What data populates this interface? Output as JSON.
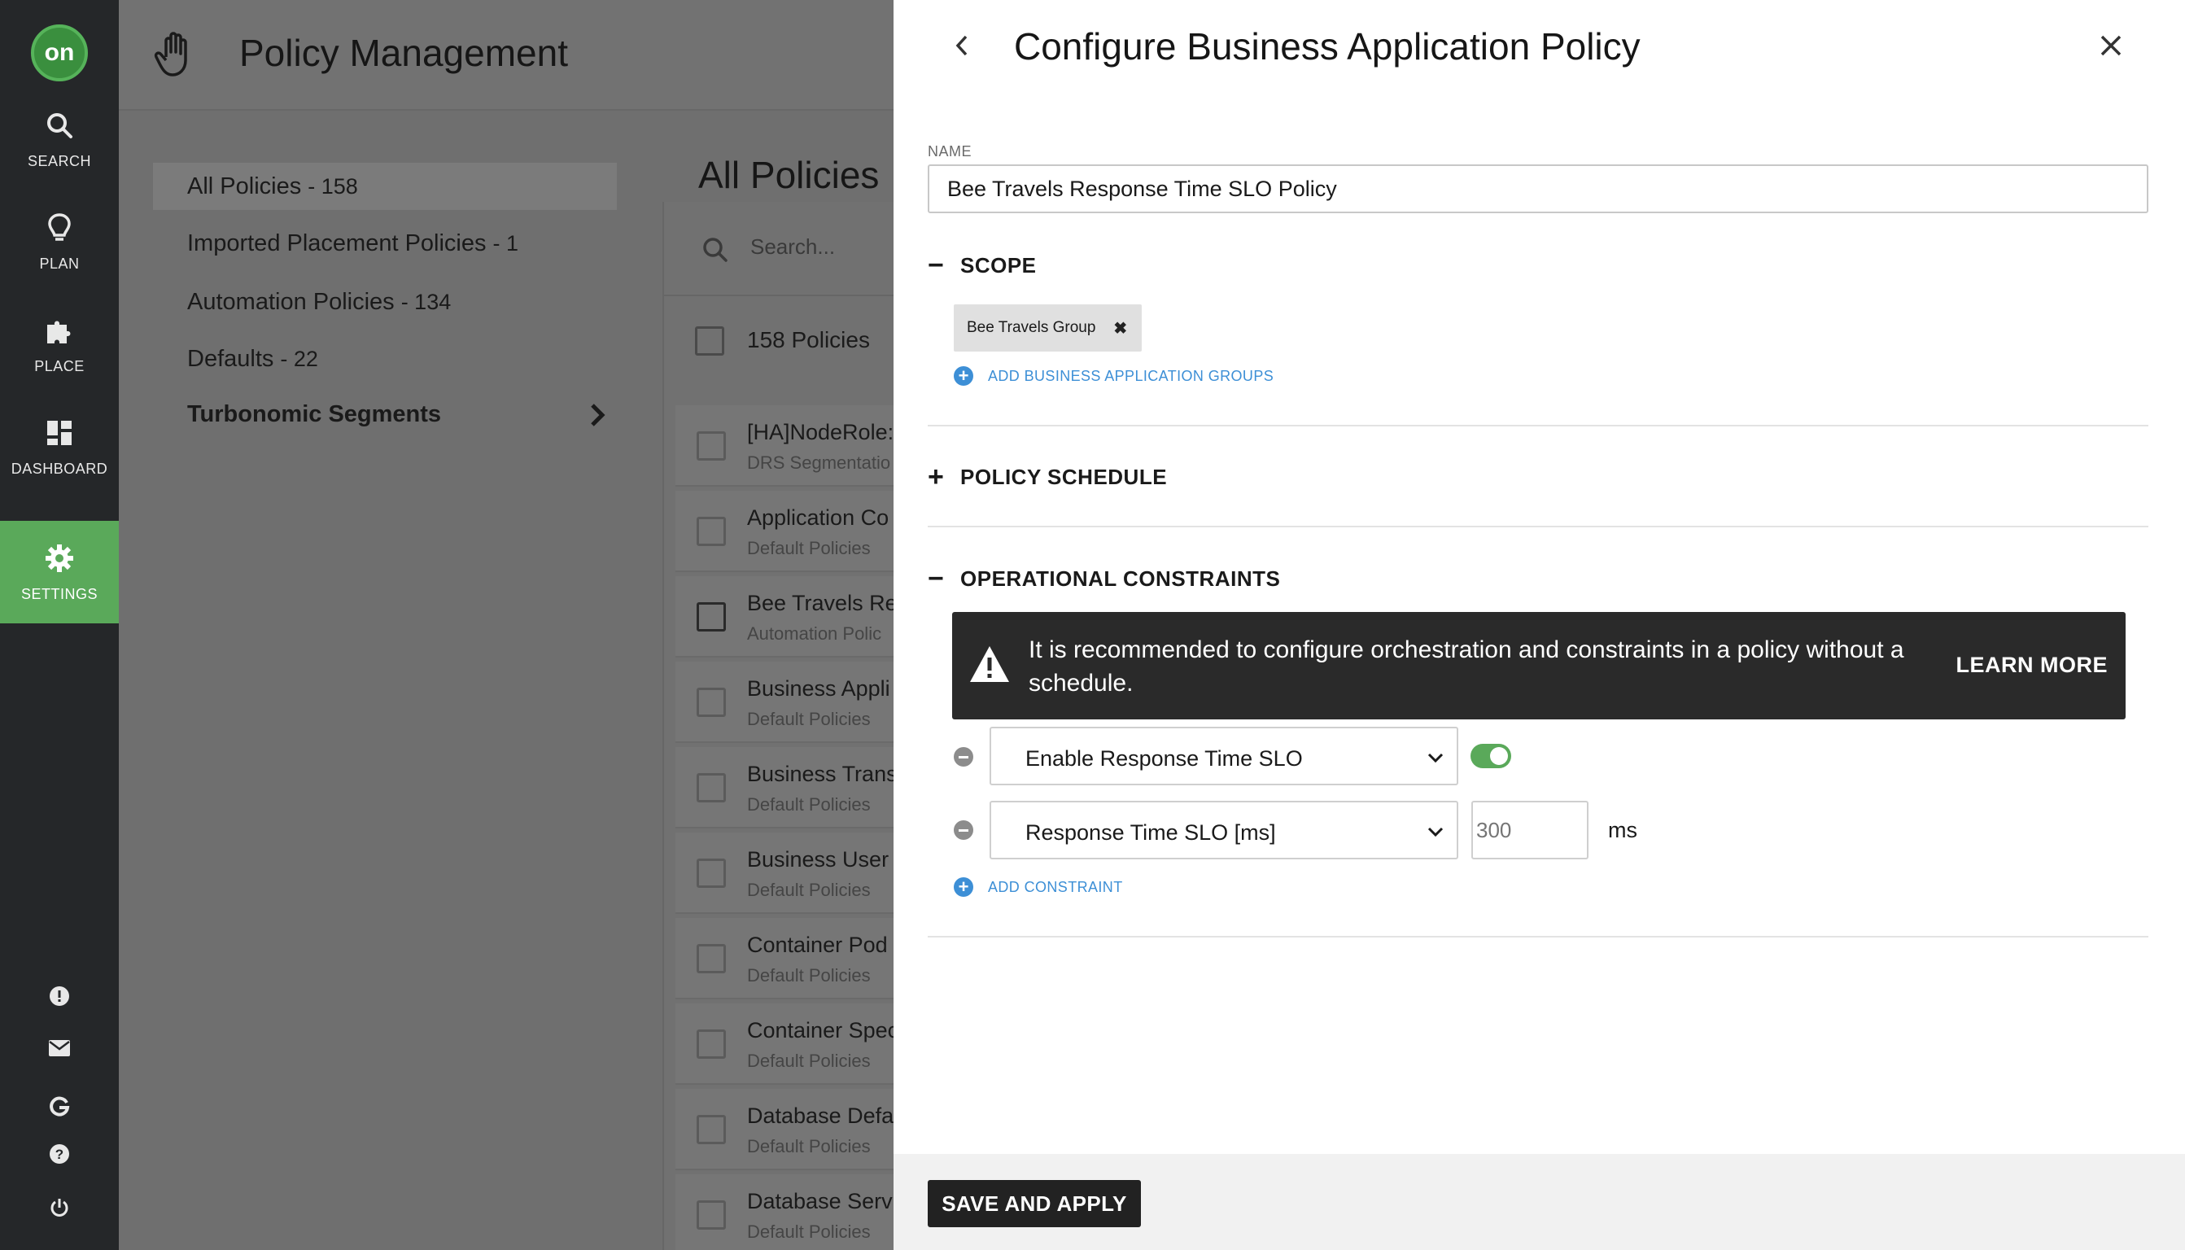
{
  "nav": {
    "logo_text": "on",
    "items": [
      {
        "label": "SEARCH",
        "icon": "search-icon"
      },
      {
        "label": "PLAN",
        "icon": "lightbulb-icon"
      },
      {
        "label": "PLACE",
        "icon": "puzzle-icon"
      },
      {
        "label": "DASHBOARD",
        "icon": "dashboard-icon"
      },
      {
        "label": "SETTINGS",
        "icon": "gear-icon",
        "active": true
      }
    ],
    "utilities": [
      "alert-icon",
      "mail-icon",
      "google-icon",
      "help-icon",
      "power-icon"
    ],
    "accent": "#5aa95a"
  },
  "page": {
    "title": "Policy Management",
    "menu": [
      {
        "label": "All Policies",
        "count": "- 158",
        "active": true
      },
      {
        "label": "Imported Placement Policies",
        "count": "- 1"
      },
      {
        "label": "Automation Policies",
        "count": "- 134"
      },
      {
        "label": "Defaults",
        "count": "- 22"
      },
      {
        "label": "Turbonomic Segments",
        "count": ""
      }
    ],
    "list_title": "All Policies",
    "search_placeholder": "Search...",
    "count_label": "158 Policies",
    "rows": [
      {
        "name": "[HA]NodeRole:",
        "type": "DRS Segmentatio"
      },
      {
        "name": "Application Co",
        "type": "Default Policies"
      },
      {
        "name": "Bee Travels Re",
        "type": "Automation Polic"
      },
      {
        "name": "Business Appli",
        "type": "Default Policies"
      },
      {
        "name": "Business Trans",
        "type": "Default Policies"
      },
      {
        "name": "Business User",
        "type": "Default Policies"
      },
      {
        "name": "Container Pod",
        "type": "Default Policies"
      },
      {
        "name": "Container Spec",
        "type": "Default Policies"
      },
      {
        "name": "Database Defa",
        "type": "Default Policies"
      },
      {
        "name": "Database Serv",
        "type": "Default Policies"
      }
    ]
  },
  "panel": {
    "title": "Configure Business Application Policy",
    "name_label": "NAME",
    "name_value": "Bee Travels Response Time SLO Policy",
    "scope": {
      "title": "SCOPE",
      "chip": "Bee Travels Group",
      "add_label": "ADD BUSINESS APPLICATION GROUPS"
    },
    "schedule": {
      "title": "POLICY SCHEDULE"
    },
    "constraints": {
      "title": "OPERATIONAL CONSTRAINTS",
      "warning": "It is recommended to configure orchestration and constraints in a policy without a schedule.",
      "learn_more": "LEARN MORE",
      "rows": [
        {
          "select": "Enable Response Time SLO",
          "toggle": true
        },
        {
          "select": "Response Time SLO [ms]",
          "value_placeholder": "300",
          "unit": "ms"
        }
      ],
      "add_label": "ADD CONSTRAINT"
    },
    "save_label": "SAVE AND APPLY"
  }
}
